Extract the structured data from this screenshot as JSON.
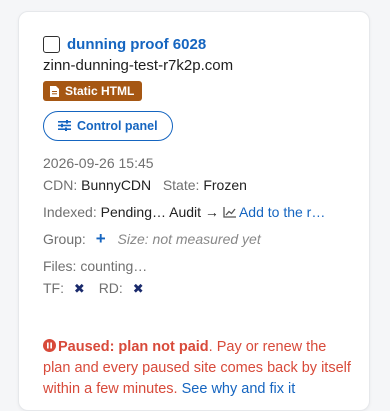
{
  "site": {
    "title": "dunning proof 6028",
    "domain": "zinn-dunning-test-r7k2p.com",
    "badge": "Static HTML",
    "control_panel_label": "Control panel"
  },
  "meta": {
    "timestamp": "2026-09-26 15:45",
    "cdn_label": "CDN:",
    "cdn_value": "BunnyCDN",
    "state_label": "State:",
    "state_value": "Frozen",
    "indexed_label": "Indexed:",
    "indexed_value": "Pending…",
    "audit_label": "Audit →",
    "add_to_label": "Add to the r…",
    "group_label": "Group:",
    "group_add": "+",
    "size_label": "Size: not measured yet",
    "files_label": "Files: counting…",
    "tf_label": "TF:",
    "tf_value": "✖",
    "rd_label": "RD:",
    "rd_value": "✖"
  },
  "notice": {
    "title": "Paused: plan not paid",
    "body": ". Pay or renew the plan and every paused site comes back by itself within a few minutes. ",
    "link": "See why and fix it"
  },
  "colors": {
    "link": "#1565c0",
    "badge": "#a65713",
    "danger": "#d84a3a"
  },
  "icons": [
    "checkbox",
    "file-icon",
    "sliders-icon",
    "chart-icon",
    "pause-circle-icon",
    "plus-icon",
    "x-icon"
  ]
}
